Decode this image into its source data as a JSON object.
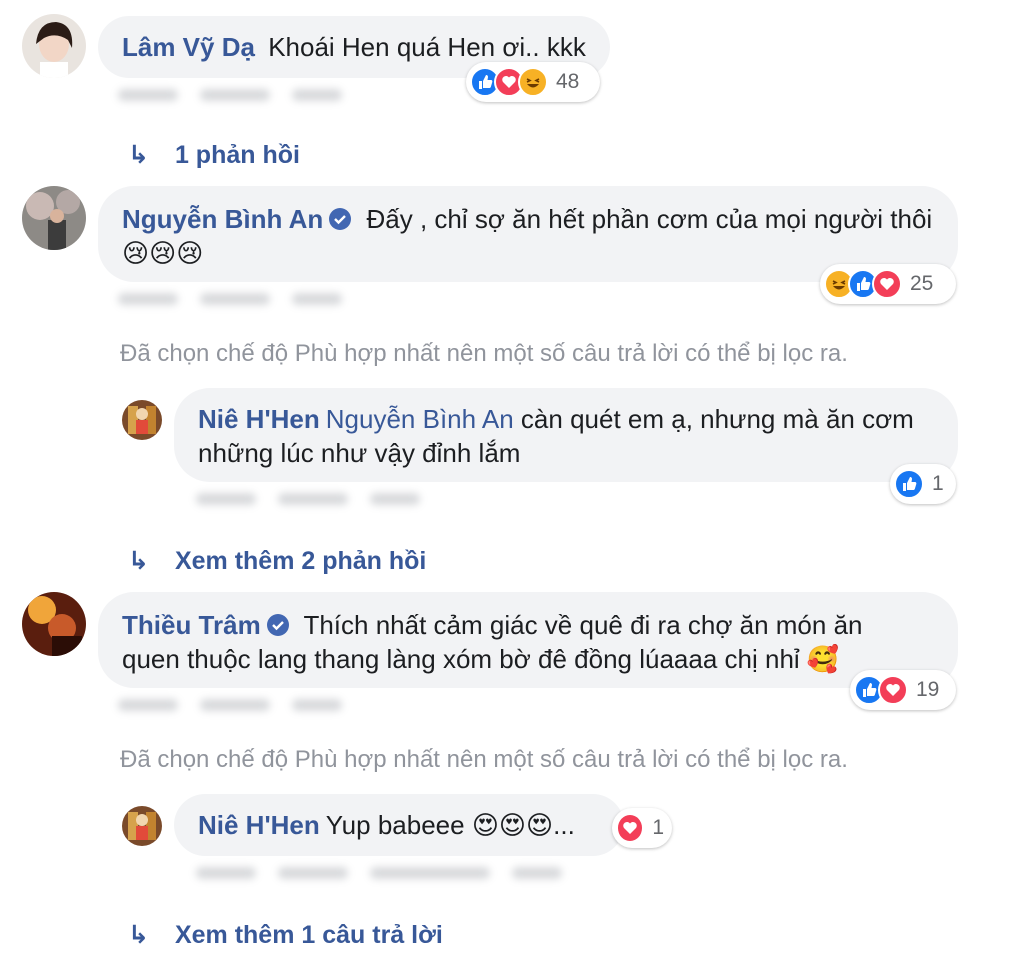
{
  "comments": [
    {
      "author": "Lâm Vỹ Dạ",
      "text": "Khoái Hen quá Hen ơi.. kkk",
      "reaction_count": "48",
      "reaction_types": [
        "like-icon",
        "love-icon",
        "haha-icon"
      ],
      "replies_label": "1 phản hồi"
    },
    {
      "author": "Nguyễn Bình An",
      "verified": true,
      "text": "Đấy , chỉ sợ ăn hết phần cơm của mọi người thôi",
      "emojis": "😢😢😢",
      "reaction_count": "25",
      "reaction_types": [
        "haha-icon",
        "like-icon",
        "love-icon"
      ],
      "filter_note": "Đã chọn chế độ Phù hợp nhất nên một số câu trả lời có thể bị lọc ra.",
      "reply": {
        "author": "Niê H'Hen",
        "mention": "Nguyễn Bình An",
        "text_line1": "càn quét em ạ, nhưng mà ăn cơm",
        "text_line2": "những lúc như vậy đỉnh lắm",
        "reaction_count": "1"
      },
      "replies_label": "Xem thêm 2 phản hồi"
    },
    {
      "author": "Thiều Trâm",
      "verified": true,
      "text_line1": "Thích nhất cảm giác về quê đi ra chợ ăn món ăn",
      "text_line2": "quen thuộc lang thang làng xóm bờ đê đồng lúaaaa chị nhỉ",
      "emojis": "🥰",
      "reaction_count": "19",
      "reaction_types": [
        "like-icon",
        "love-icon"
      ],
      "filter_note": "Đã chọn chế độ Phù hợp nhất nên một số câu trả lời có thể bị lọc ra.",
      "reply": {
        "author": "Niê H'Hen",
        "text": "Yup babeee",
        "emojis": "😍😍😍...",
        "reaction_count": "1"
      },
      "replies_label": "Xem thêm 1 câu trả lời"
    }
  ],
  "colors": {
    "link": "#385898",
    "bubble": "#f2f3f5",
    "muted": "#90949c",
    "like": "#1877f2",
    "love": "#f33e58"
  }
}
